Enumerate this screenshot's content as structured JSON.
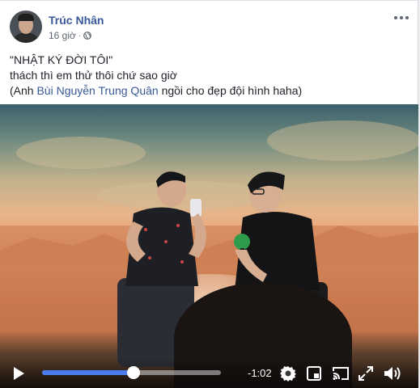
{
  "post": {
    "author": "Trúc Nhân",
    "time": "16 giờ",
    "privacy_icon": "globe-icon",
    "more_icon": "ellipsis-icon"
  },
  "text": {
    "line1": "\"NHẬT KÝ ĐỜI TÔI\"",
    "line2": "thách thì em thử thôi chứ sao giờ",
    "line3_prefix": "(Anh ",
    "line3_link": "Bùi Nguyễn Trung Quân",
    "line3_suffix": " ngồi cho đẹp đội hình haha)"
  },
  "video": {
    "remaining_time": "-1:02",
    "progress": 0.51,
    "play_icon": "play-icon",
    "settings_icon": "gear-icon",
    "pip_icon": "picture-in-picture-icon",
    "cast_icon": "cast-icon",
    "fullscreen_icon": "fullscreen-icon",
    "volume_icon": "volume-icon"
  },
  "colors": {
    "link": "#385898",
    "progress_fill": "#4b7bec"
  }
}
